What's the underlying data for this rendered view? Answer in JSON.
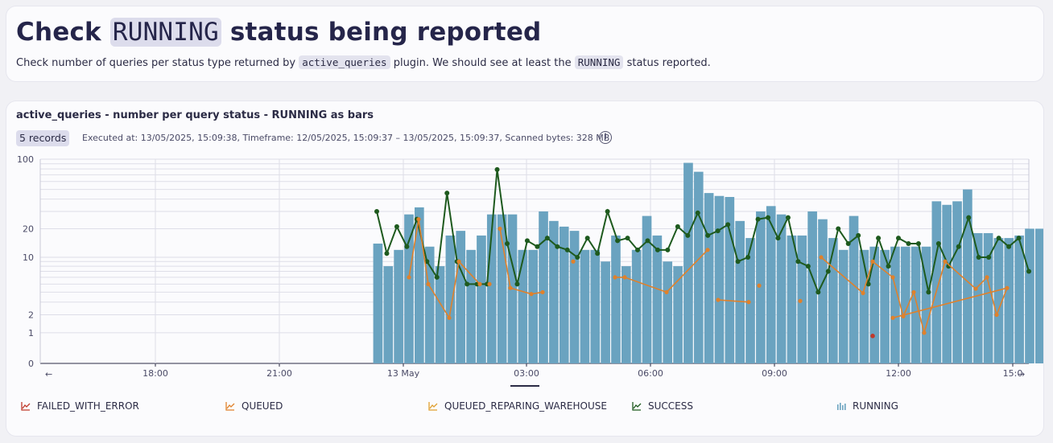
{
  "header": {
    "title_pre": "Check",
    "title_code": "RUNNING",
    "title_post": "status being reported",
    "desc_pre": "Check number of queries per status type returned by",
    "desc_code1": "active_queries",
    "desc_mid": "plugin. We should see at least the",
    "desc_code2": "RUNNING",
    "desc_post": "status reported."
  },
  "chart_card": {
    "title": "active_queries - number per query status - RUNNING as bars",
    "records": "5 records",
    "meta": "Executed at: 13/05/2025, 15:09:38, Timeframe: 12/05/2025, 15:09:37 – 13/05/2025, 15:09:37, Scanned bytes: 328 MB",
    "prev_label": "←",
    "next_label": "→"
  },
  "legend": [
    {
      "label": "FAILED_WITH_ERROR",
      "color": "#c0392b",
      "kind": "line"
    },
    {
      "label": "QUEUED",
      "color": "#e0812b",
      "kind": "line"
    },
    {
      "label": "QUEUED_REPARING_WAREHOUSE",
      "color": "#e0a030",
      "kind": "line"
    },
    {
      "label": "SUCCESS",
      "color": "#1e5a1e",
      "kind": "line"
    },
    {
      "label": "RUNNING",
      "color": "#6aa3c0",
      "kind": "bar"
    }
  ],
  "chart_data": {
    "type": "bar",
    "yscale": "symlog",
    "y_ticks": [
      "0",
      "1",
      "2",
      "10",
      "20",
      "100"
    ],
    "x_ticks": [
      "18:00",
      "21:00",
      "13 May",
      "03:00",
      "06:00",
      "09:00",
      "12:00",
      "15:0"
    ],
    "colors": {
      "running": "#6aa3c0",
      "success": "#1e5a1e",
      "queued": "#e0812b",
      "failed": "#c0392b"
    },
    "series": [
      {
        "name": "RUNNING",
        "values": [
          14,
          8,
          12,
          28,
          33,
          13,
          8,
          17,
          19,
          12,
          17,
          28,
          28,
          28,
          12,
          12,
          30,
          24,
          21,
          19,
          12,
          12,
          9,
          17,
          8,
          12,
          27,
          17,
          9,
          8,
          92,
          75,
          46,
          43,
          42,
          24,
          16,
          30,
          34,
          28,
          17,
          17,
          30,
          25,
          16,
          12,
          27,
          12,
          13,
          12,
          13,
          13,
          13,
          13,
          38,
          35,
          38,
          50,
          18,
          18,
          16,
          16,
          17,
          20,
          20,
          13,
          12,
          25,
          14,
          16,
          16,
          6
        ]
      },
      {
        "name": "SUCCESS",
        "values": [
          30,
          11,
          21,
          13,
          25,
          9,
          6,
          46,
          9,
          5,
          5,
          5,
          79,
          14,
          5,
          15,
          13,
          16,
          13,
          12,
          10,
          16,
          11,
          30,
          15,
          16,
          12,
          15,
          12,
          12,
          21,
          17,
          29,
          17,
          19,
          22,
          9,
          10,
          25,
          26,
          16,
          26,
          9,
          8,
          4,
          7,
          20,
          14,
          17,
          5,
          16,
          8,
          16,
          14,
          14,
          4,
          14,
          8,
          13,
          26,
          10,
          10,
          16,
          13,
          16,
          7
        ]
      },
      {
        "name": "QUEUED",
        "values": [
          6,
          25,
          5,
          1.8,
          9,
          5,
          5,
          20,
          4.5,
          3.8,
          4,
          9,
          6,
          6,
          4,
          12,
          3.2,
          3,
          4.8,
          3.1,
          10,
          3.9,
          9,
          6,
          1.9,
          4,
          1,
          9,
          4.4,
          6,
          2,
          4.5,
          1.8
        ]
      },
      {
        "name": "FAILED_WITH_ERROR",
        "values": [
          1
        ]
      }
    ]
  }
}
